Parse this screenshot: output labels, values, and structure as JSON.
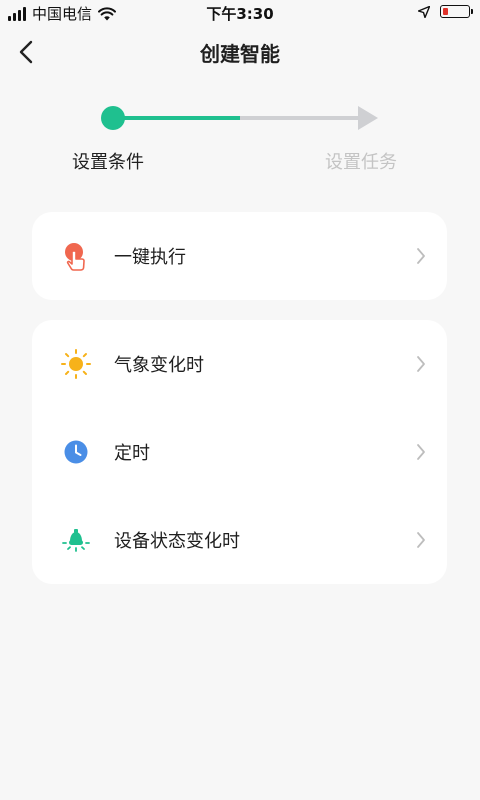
{
  "status_bar": {
    "carrier": "中国电信",
    "time": "下午3:30"
  },
  "nav": {
    "title": "创建智能"
  },
  "stepper": {
    "step1_label": "设置条件",
    "step2_label": "设置任务",
    "active_step": 1,
    "active_color": "#1fc08f",
    "inactive_color": "#cfd0d3"
  },
  "cards": {
    "manual": {
      "label": "一键执行",
      "icon": "tap-hand-icon",
      "icon_color": "#f0674f"
    },
    "conditions": [
      {
        "label": "气象变化时",
        "icon": "sun-icon",
        "icon_color": "#f7b21a"
      },
      {
        "label": "定时",
        "icon": "clock-icon",
        "icon_color": "#4a8ee6"
      },
      {
        "label": "设备状态变化时",
        "icon": "bulb-icon",
        "icon_color": "#1fc08f"
      }
    ]
  }
}
